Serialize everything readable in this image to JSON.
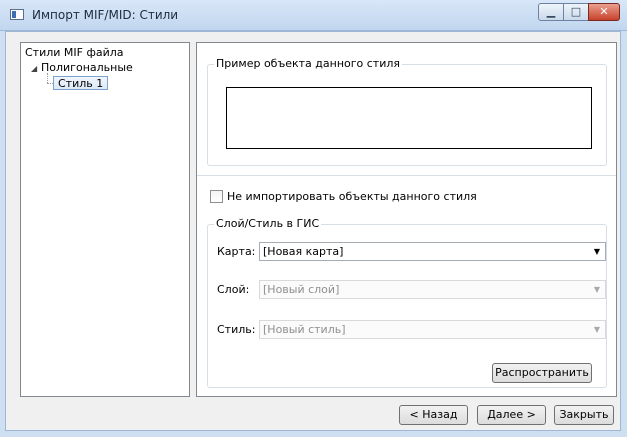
{
  "window": {
    "title": "Импорт MIF/MID: Стили",
    "min_glyph": "▁",
    "max_glyph": "□",
    "close_glyph": "✕"
  },
  "tree": {
    "header": "Стили MIF файла",
    "expand_glyph": "◢",
    "node": "Полигональные",
    "leaf": "Стиль 1"
  },
  "preview": {
    "legend": "Пример объекта данного стиля"
  },
  "options": {
    "skip_label": "Не импортировать объекты данного стиля",
    "skip_checked": false
  },
  "gis": {
    "legend": "Слой/Стиль в ГИС",
    "map_label": "Карта:",
    "map_value": "[Новая карта]",
    "layer_label": "Слой:",
    "layer_value": "[Новый слой]",
    "style_label": "Стиль:",
    "style_value": "[Новый стиль]",
    "dropdown_glyph": "▼",
    "spread_button": "Распространить"
  },
  "footer": {
    "back": "< Назад",
    "next": "Далее >",
    "close": "Закрыть"
  }
}
